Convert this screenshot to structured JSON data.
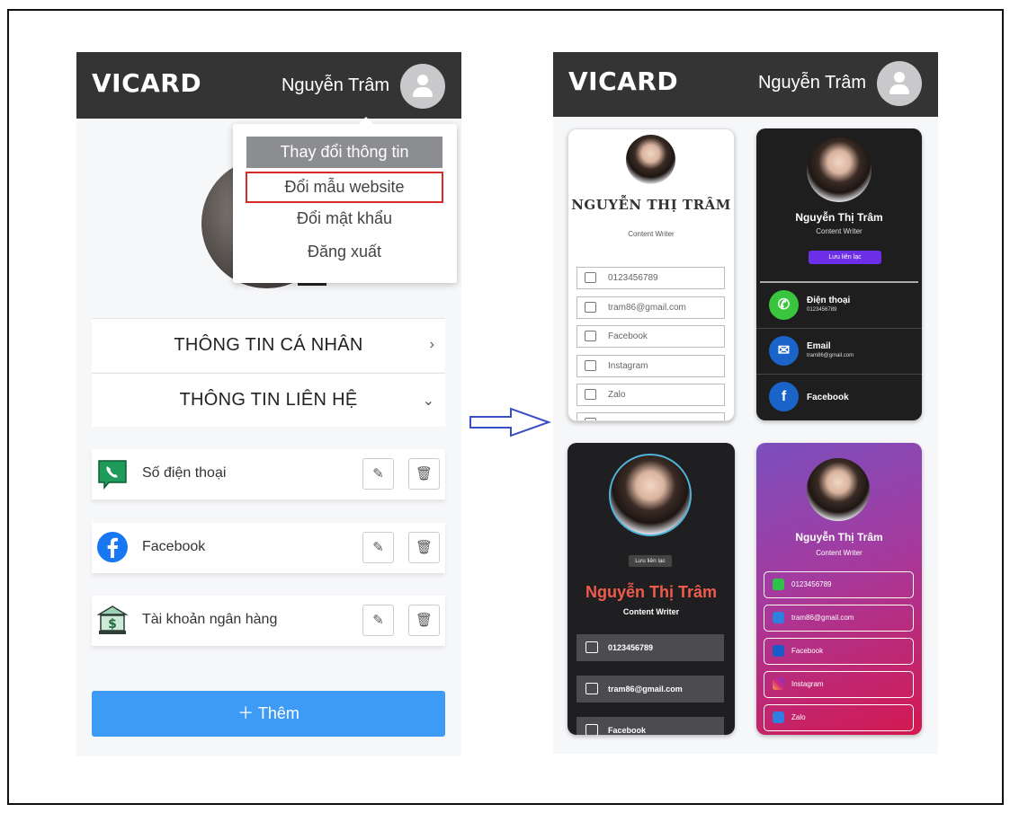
{
  "left_screen": {
    "brand": "VICARD",
    "user_name": "Nguyễn Trâm",
    "dropdown": {
      "items": [
        "Thay đổi thông tin",
        "Đổi mẫu website",
        "Đổi mật khẩu",
        "Đăng xuất"
      ]
    },
    "sections": [
      {
        "title": "THÔNG TIN CÁ NHÂN",
        "chevron": "›"
      },
      {
        "title": "THÔNG TIN LIÊN HỆ",
        "chevron": "⌄"
      }
    ],
    "contacts": [
      {
        "label": "Số điện thoại",
        "icon": "phone-chat-icon"
      },
      {
        "label": "Facebook",
        "icon": "facebook-icon"
      },
      {
        "label": "Tài khoản ngân hàng",
        "icon": "bank-icon"
      }
    ],
    "add_button": "＋ Thêm"
  },
  "right_screen": {
    "brand": "VICARD",
    "user_name": "Nguyễn Trâm",
    "card1": {
      "name": "NGUYỄN THỊ TRÂM",
      "title": "Content Writer",
      "rows": [
        "0123456789",
        "tram86@gmail.com",
        "Facebook",
        "Instagram",
        "Zalo"
      ]
    },
    "card2": {
      "name": "Nguyễn Thị Trâm",
      "title": "Content Writer",
      "save": "Lưu liên lạc",
      "rows": [
        {
          "title": "Điện thoại",
          "sub": "0123456789"
        },
        {
          "title": "Email",
          "sub": "tram86@gmail.com"
        },
        {
          "title": "Facebook",
          "sub": ""
        }
      ]
    },
    "card3": {
      "save": "Lưu liên lạc",
      "name": "Nguyễn Thị Trâm",
      "title": "Content Writer",
      "rows": [
        "0123456789",
        "tram86@gmail.com",
        "Facebook"
      ]
    },
    "card4": {
      "name": "Nguyễn Thị Trâm",
      "title": "Content Writer",
      "rows": [
        "0123456789",
        "tram86@gmail.com",
        "Facebook",
        "Instagram",
        "Zalo"
      ]
    }
  },
  "colors": {
    "header_bg": "#343434",
    "add_button": "#3d9bf5",
    "highlight_border": "#d52b2b",
    "arrow": "#3a4fc4"
  }
}
